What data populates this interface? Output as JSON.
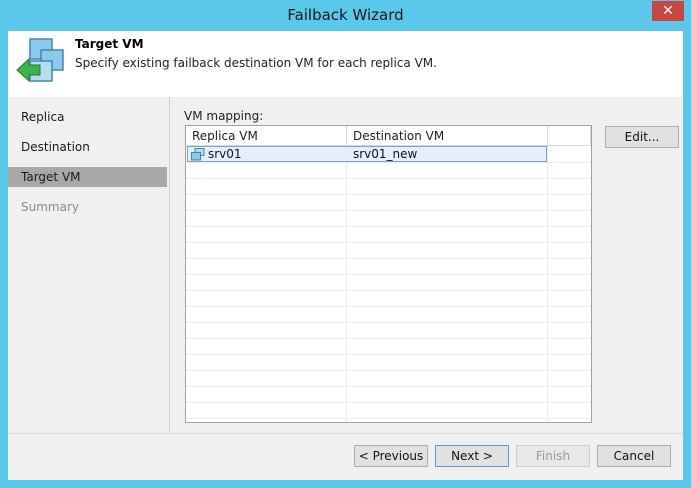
{
  "window": {
    "title": "Failback Wizard",
    "close_glyph": "✕"
  },
  "header": {
    "title": "Target VM",
    "description": "Specify existing failback destination VM for each replica VM.",
    "icon": "failback-wizard-icon"
  },
  "steps": [
    {
      "label": "Replica",
      "state": "normal"
    },
    {
      "label": "Destination",
      "state": "normal"
    },
    {
      "label": "Target VM",
      "state": "active"
    },
    {
      "label": "Summary",
      "state": "disabled"
    }
  ],
  "mapping": {
    "label": "VM mapping:",
    "columns": [
      "Replica VM",
      "Destination VM"
    ],
    "rows": [
      {
        "replica": "srv01",
        "destination": "srv01_new",
        "icon": "vm-icon"
      }
    ]
  },
  "buttons": {
    "edit": "Edit...",
    "previous": "< Previous",
    "next": "Next >",
    "finish": "Finish",
    "cancel": "Cancel"
  },
  "colors": {
    "title_bar": "#5ac8ea",
    "close_button": "#c7463d",
    "active_step": "#a8a8a8",
    "selected_row": "#e5effb"
  }
}
